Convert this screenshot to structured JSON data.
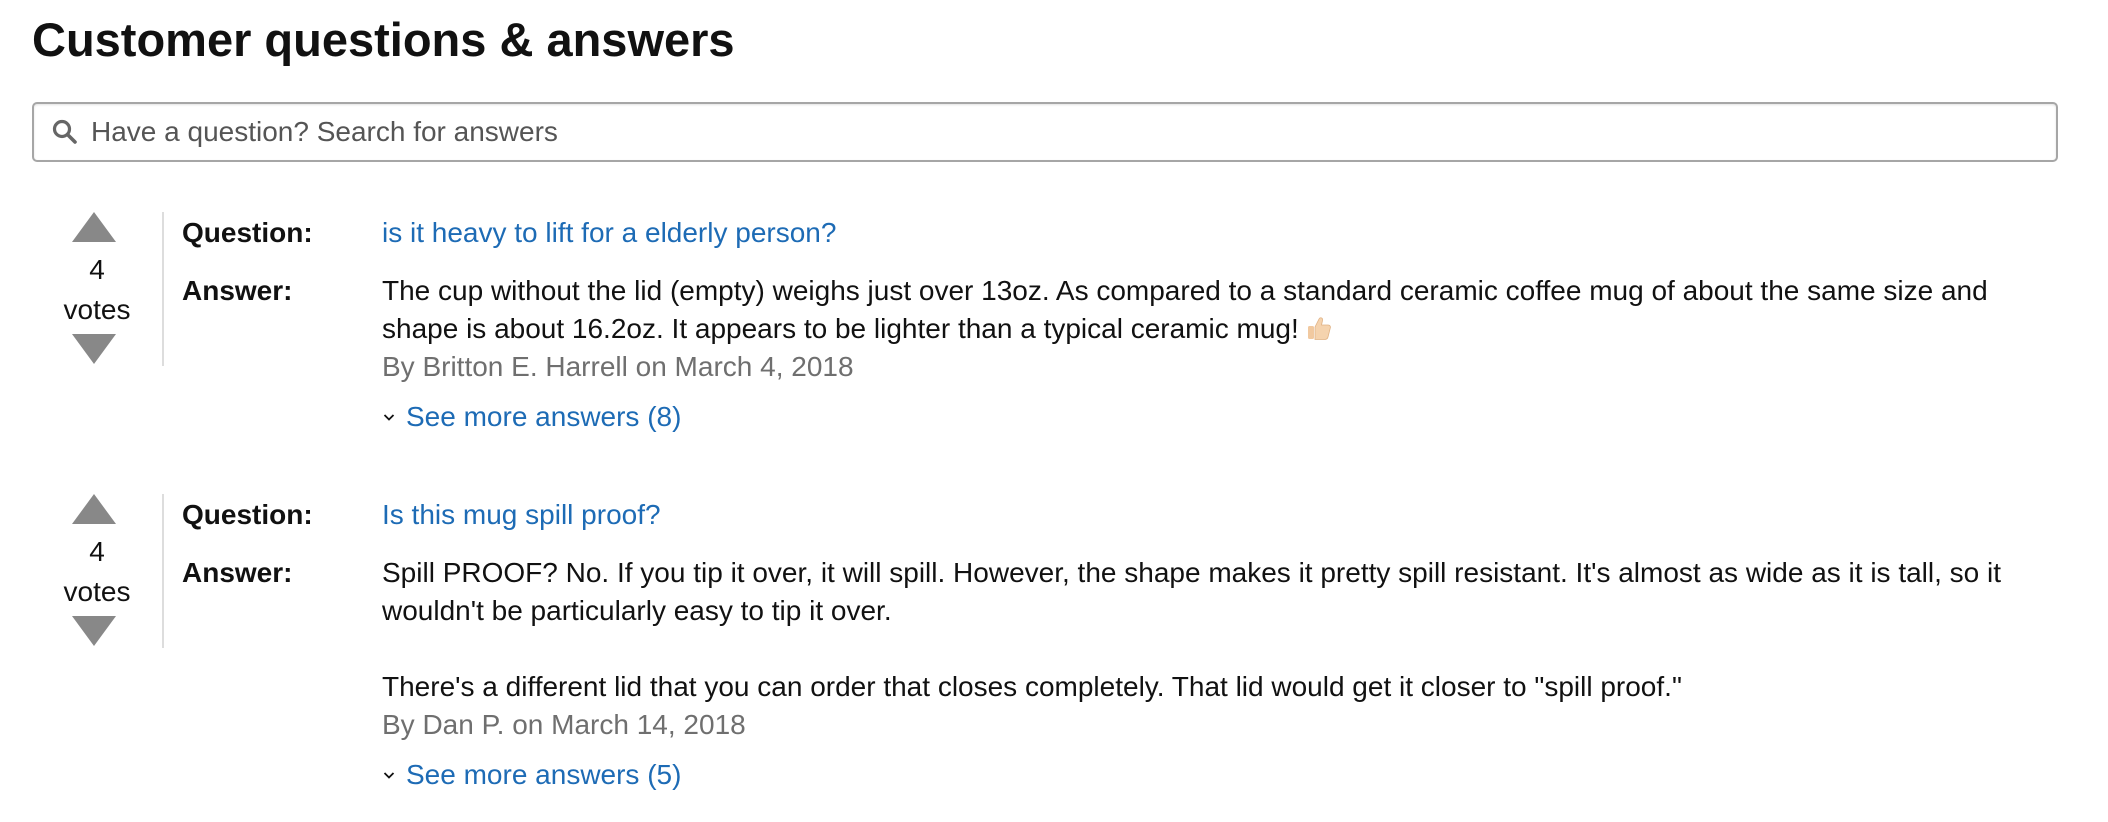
{
  "section_title": "Customer questions & answers",
  "search": {
    "placeholder": "Have a question? Search for answers",
    "icon": "search-icon"
  },
  "items": [
    {
      "votes": {
        "count": "4",
        "label": "votes"
      },
      "question_label": "Question:",
      "question": "is it heavy to lift for a elderly person?",
      "answer_label": "Answer:",
      "answer_paragraphs": [
        "The cup without the lid (empty) weighs just over 13oz. As compared to a standard ceramic coffee mug of about the same size and shape is about 16.2oz. It appears to be lighter than a typical ceramic mug!"
      ],
      "answer_emoji": "thumbs-up-icon",
      "byline": "By Britton E. Harrell on March 4, 2018",
      "see_more": "See more answers (8)"
    },
    {
      "votes": {
        "count": "4",
        "label": "votes"
      },
      "question_label": "Question:",
      "question": "Is this mug spill proof?",
      "answer_label": "Answer:",
      "answer_paragraphs": [
        "Spill PROOF? No. If you tip it over, it will spill. However, the shape makes it pretty spill resistant. It's almost as wide as it is tall, so it wouldn't be particularly easy to tip it over.",
        "There's a different lid that you can order that closes completely. That lid would get it closer to \"spill proof.\""
      ],
      "byline": "By Dan P. on March 14, 2018",
      "see_more": "See more answers (5)"
    }
  ],
  "colors": {
    "link": "#1d6bb5",
    "byline": "#6f6f6f",
    "vote_arrow": "#888888",
    "text": "#111111"
  }
}
